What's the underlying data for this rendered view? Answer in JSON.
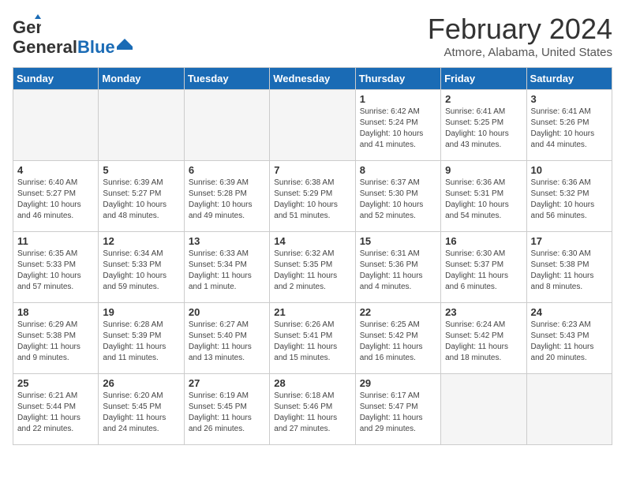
{
  "header": {
    "logo_general": "General",
    "logo_blue": "Blue",
    "month_title": "February 2024",
    "location": "Atmore, Alabama, United States"
  },
  "days_of_week": [
    "Sunday",
    "Monday",
    "Tuesday",
    "Wednesday",
    "Thursday",
    "Friday",
    "Saturday"
  ],
  "weeks": [
    [
      {
        "day": "",
        "info": ""
      },
      {
        "day": "",
        "info": ""
      },
      {
        "day": "",
        "info": ""
      },
      {
        "day": "",
        "info": ""
      },
      {
        "day": "1",
        "info": "Sunrise: 6:42 AM\nSunset: 5:24 PM\nDaylight: 10 hours\nand 41 minutes."
      },
      {
        "day": "2",
        "info": "Sunrise: 6:41 AM\nSunset: 5:25 PM\nDaylight: 10 hours\nand 43 minutes."
      },
      {
        "day": "3",
        "info": "Sunrise: 6:41 AM\nSunset: 5:26 PM\nDaylight: 10 hours\nand 44 minutes."
      }
    ],
    [
      {
        "day": "4",
        "info": "Sunrise: 6:40 AM\nSunset: 5:27 PM\nDaylight: 10 hours\nand 46 minutes."
      },
      {
        "day": "5",
        "info": "Sunrise: 6:39 AM\nSunset: 5:27 PM\nDaylight: 10 hours\nand 48 minutes."
      },
      {
        "day": "6",
        "info": "Sunrise: 6:39 AM\nSunset: 5:28 PM\nDaylight: 10 hours\nand 49 minutes."
      },
      {
        "day": "7",
        "info": "Sunrise: 6:38 AM\nSunset: 5:29 PM\nDaylight: 10 hours\nand 51 minutes."
      },
      {
        "day": "8",
        "info": "Sunrise: 6:37 AM\nSunset: 5:30 PM\nDaylight: 10 hours\nand 52 minutes."
      },
      {
        "day": "9",
        "info": "Sunrise: 6:36 AM\nSunset: 5:31 PM\nDaylight: 10 hours\nand 54 minutes."
      },
      {
        "day": "10",
        "info": "Sunrise: 6:36 AM\nSunset: 5:32 PM\nDaylight: 10 hours\nand 56 minutes."
      }
    ],
    [
      {
        "day": "11",
        "info": "Sunrise: 6:35 AM\nSunset: 5:33 PM\nDaylight: 10 hours\nand 57 minutes."
      },
      {
        "day": "12",
        "info": "Sunrise: 6:34 AM\nSunset: 5:33 PM\nDaylight: 10 hours\nand 59 minutes."
      },
      {
        "day": "13",
        "info": "Sunrise: 6:33 AM\nSunset: 5:34 PM\nDaylight: 11 hours\nand 1 minute."
      },
      {
        "day": "14",
        "info": "Sunrise: 6:32 AM\nSunset: 5:35 PM\nDaylight: 11 hours\nand 2 minutes."
      },
      {
        "day": "15",
        "info": "Sunrise: 6:31 AM\nSunset: 5:36 PM\nDaylight: 11 hours\nand 4 minutes."
      },
      {
        "day": "16",
        "info": "Sunrise: 6:30 AM\nSunset: 5:37 PM\nDaylight: 11 hours\nand 6 minutes."
      },
      {
        "day": "17",
        "info": "Sunrise: 6:30 AM\nSunset: 5:38 PM\nDaylight: 11 hours\nand 8 minutes."
      }
    ],
    [
      {
        "day": "18",
        "info": "Sunrise: 6:29 AM\nSunset: 5:38 PM\nDaylight: 11 hours\nand 9 minutes."
      },
      {
        "day": "19",
        "info": "Sunrise: 6:28 AM\nSunset: 5:39 PM\nDaylight: 11 hours\nand 11 minutes."
      },
      {
        "day": "20",
        "info": "Sunrise: 6:27 AM\nSunset: 5:40 PM\nDaylight: 11 hours\nand 13 minutes."
      },
      {
        "day": "21",
        "info": "Sunrise: 6:26 AM\nSunset: 5:41 PM\nDaylight: 11 hours\nand 15 minutes."
      },
      {
        "day": "22",
        "info": "Sunrise: 6:25 AM\nSunset: 5:42 PM\nDaylight: 11 hours\nand 16 minutes."
      },
      {
        "day": "23",
        "info": "Sunrise: 6:24 AM\nSunset: 5:42 PM\nDaylight: 11 hours\nand 18 minutes."
      },
      {
        "day": "24",
        "info": "Sunrise: 6:23 AM\nSunset: 5:43 PM\nDaylight: 11 hours\nand 20 minutes."
      }
    ],
    [
      {
        "day": "25",
        "info": "Sunrise: 6:21 AM\nSunset: 5:44 PM\nDaylight: 11 hours\nand 22 minutes."
      },
      {
        "day": "26",
        "info": "Sunrise: 6:20 AM\nSunset: 5:45 PM\nDaylight: 11 hours\nand 24 minutes."
      },
      {
        "day": "27",
        "info": "Sunrise: 6:19 AM\nSunset: 5:45 PM\nDaylight: 11 hours\nand 26 minutes."
      },
      {
        "day": "28",
        "info": "Sunrise: 6:18 AM\nSunset: 5:46 PM\nDaylight: 11 hours\nand 27 minutes."
      },
      {
        "day": "29",
        "info": "Sunrise: 6:17 AM\nSunset: 5:47 PM\nDaylight: 11 hours\nand 29 minutes."
      },
      {
        "day": "",
        "info": ""
      },
      {
        "day": "",
        "info": ""
      }
    ]
  ]
}
